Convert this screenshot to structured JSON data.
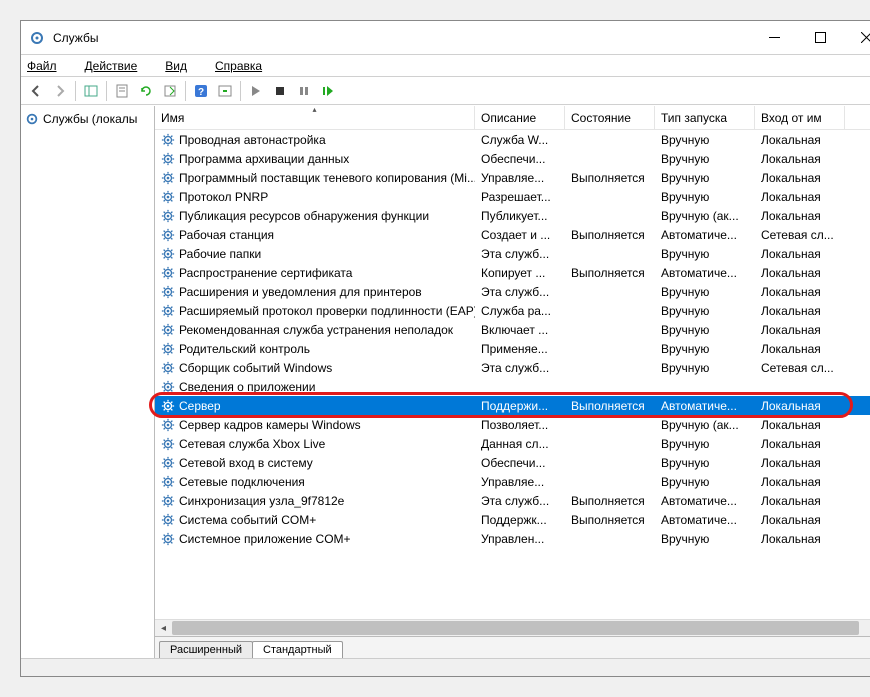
{
  "window": {
    "title": "Службы"
  },
  "menu": {
    "file": "Файл",
    "action": "Действие",
    "view": "Вид",
    "help": "Справка"
  },
  "left_pane": {
    "root": "Службы (локалы"
  },
  "columns": {
    "name": "Имя",
    "desc": "Описание",
    "state": "Состояние",
    "startup": "Тип запуска",
    "logon": "Вход от им"
  },
  "tabs": {
    "extended": "Расширенный",
    "standard": "Стандартный"
  },
  "services": [
    {
      "name": "Проводная автонастройка",
      "desc": "Служба W...",
      "state": "",
      "startup": "Вручную",
      "logon": "Локальная"
    },
    {
      "name": "Программа архивации данных",
      "desc": "Обеспечи...",
      "state": "",
      "startup": "Вручную",
      "logon": "Локальная"
    },
    {
      "name": "Программный поставщик теневого копирования (Mi...",
      "desc": "Управляе...",
      "state": "Выполняется",
      "startup": "Вручную",
      "logon": "Локальная"
    },
    {
      "name": "Протокол PNRP",
      "desc": "Разрешает...",
      "state": "",
      "startup": "Вручную",
      "logon": "Локальная"
    },
    {
      "name": "Публикация ресурсов обнаружения функции",
      "desc": "Публикует...",
      "state": "",
      "startup": "Вручную (ак...",
      "logon": "Локальная"
    },
    {
      "name": "Рабочая станция",
      "desc": "Создает и ...",
      "state": "Выполняется",
      "startup": "Автоматиче...",
      "logon": "Сетевая сл..."
    },
    {
      "name": "Рабочие папки",
      "desc": "Эта служб...",
      "state": "",
      "startup": "Вручную",
      "logon": "Локальная"
    },
    {
      "name": "Распространение сертификата",
      "desc": "Копирует ...",
      "state": "Выполняется",
      "startup": "Автоматиче...",
      "logon": "Локальная"
    },
    {
      "name": "Расширения и уведомления для принтеров",
      "desc": "Эта служб...",
      "state": "",
      "startup": "Вручную",
      "logon": "Локальная"
    },
    {
      "name": "Расширяемый протокол проверки подлинности (EAP)",
      "desc": "Служба ра...",
      "state": "",
      "startup": "Вручную",
      "logon": "Локальная"
    },
    {
      "name": "Рекомендованная служба устранения неполадок",
      "desc": "Включает ...",
      "state": "",
      "startup": "Вручную",
      "logon": "Локальная"
    },
    {
      "name": "Родительский контроль",
      "desc": "Применяе...",
      "state": "",
      "startup": "Вручную",
      "logon": "Локальная"
    },
    {
      "name": "Сборщик событий Windows",
      "desc": "Эта служб...",
      "state": "",
      "startup": "Вручную",
      "logon": "Сетевая сл..."
    },
    {
      "name": "Сведения о приложении",
      "desc": "",
      "state": "",
      "startup": "",
      "logon": ""
    },
    {
      "name": "Сервер",
      "desc": "Поддержи...",
      "state": "Выполняется",
      "startup": "Автоматиче...",
      "logon": "Локальная",
      "selected": true
    },
    {
      "name": "Сервер кадров камеры Windows",
      "desc": "Позволяет...",
      "state": "",
      "startup": "Вручную (ак...",
      "logon": "Локальная"
    },
    {
      "name": "Сетевая служба Xbox Live",
      "desc": "Данная сл...",
      "state": "",
      "startup": "Вручную",
      "logon": "Локальная"
    },
    {
      "name": "Сетевой вход в систему",
      "desc": "Обеспечи...",
      "state": "",
      "startup": "Вручную",
      "logon": "Локальная"
    },
    {
      "name": "Сетевые подключения",
      "desc": "Управляе...",
      "state": "",
      "startup": "Вручную",
      "logon": "Локальная"
    },
    {
      "name": "Синхронизация узла_9f7812e",
      "desc": "Эта служб...",
      "state": "Выполняется",
      "startup": "Автоматиче...",
      "logon": "Локальная"
    },
    {
      "name": "Система событий COM+",
      "desc": "Поддержк...",
      "state": "Выполняется",
      "startup": "Автоматиче...",
      "logon": "Локальная"
    },
    {
      "name": "Системное приложение COM+",
      "desc": "Управлен...",
      "state": "",
      "startup": "Вручную",
      "logon": "Локальная"
    }
  ]
}
